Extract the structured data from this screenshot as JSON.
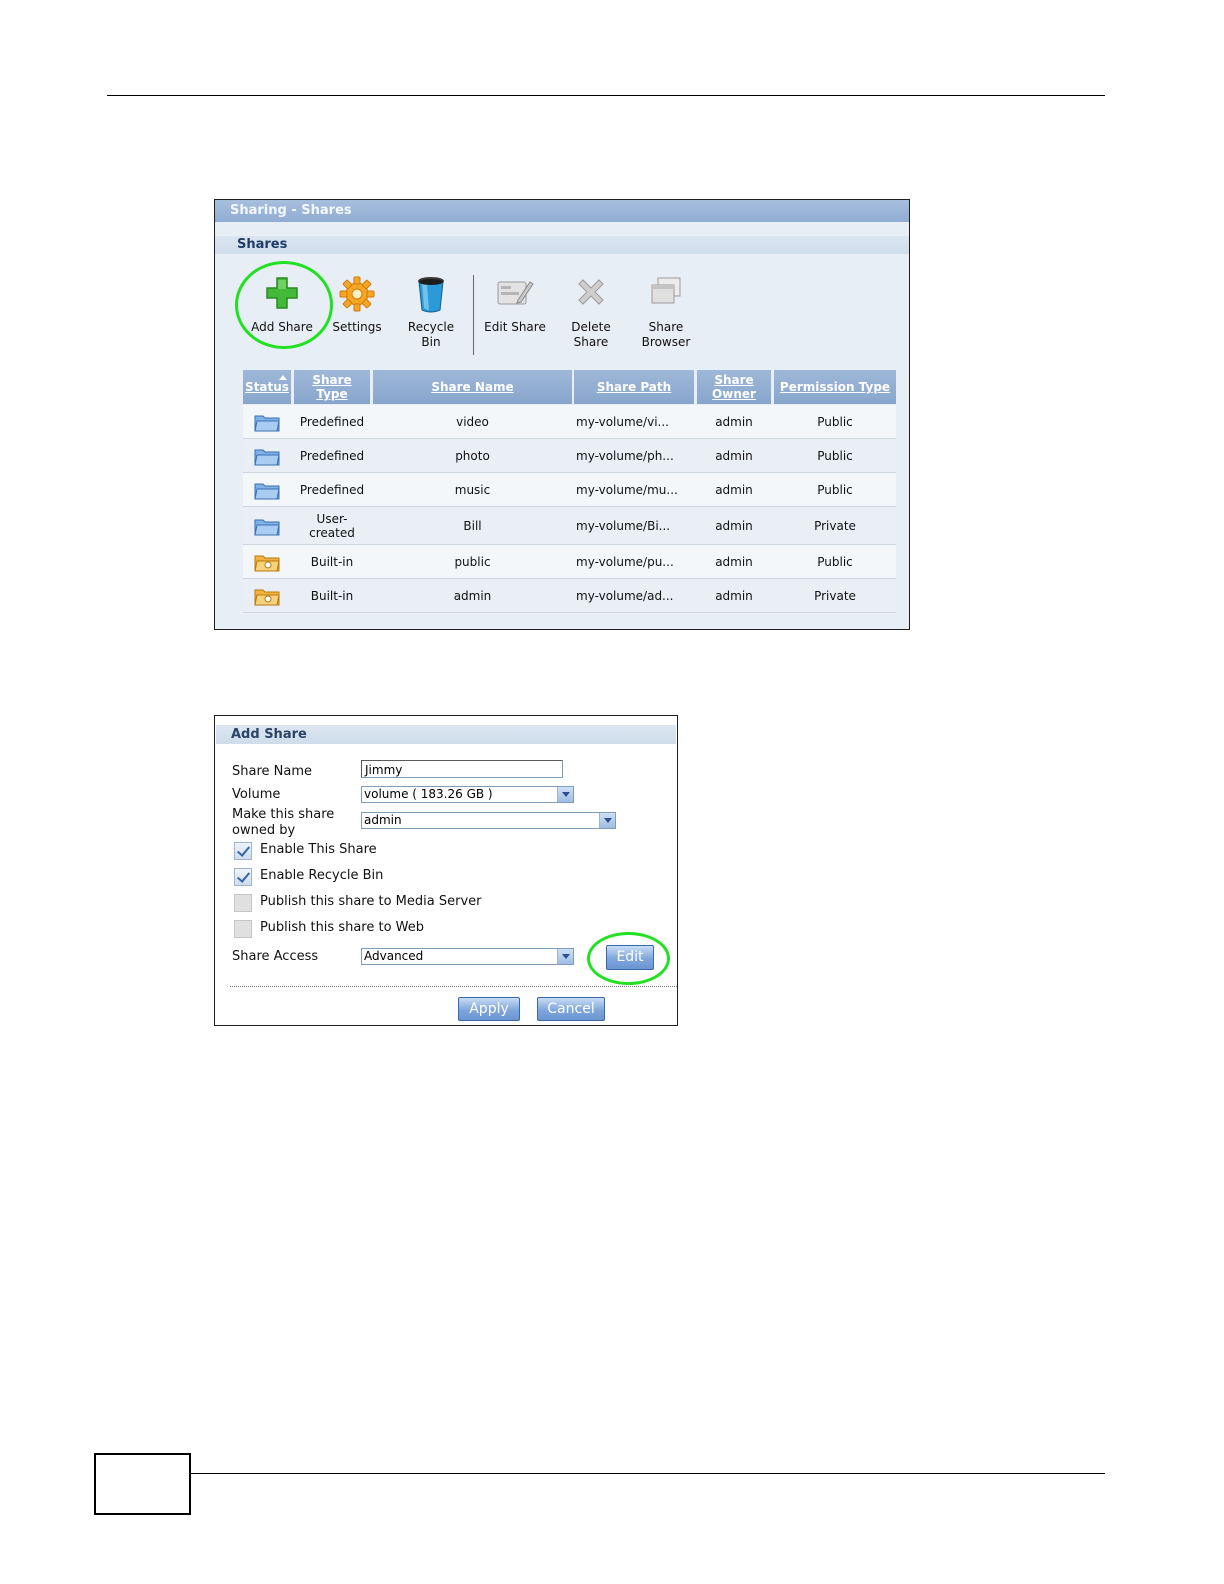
{
  "shares_panel": {
    "title": "Sharing - Shares",
    "section_title": "Shares",
    "toolbar": {
      "add_share": "Add Share",
      "settings": "Settings",
      "recycle_bin_1": "Recycle",
      "recycle_bin_2": "Bin",
      "edit_share": "Edit Share",
      "delete_share_1": "Delete",
      "delete_share_2": "Share",
      "share_browser_1": "Share",
      "share_browser_2": "Browser"
    },
    "columns": {
      "status": "Status",
      "share_type_1": "Share",
      "share_type_2": "Type",
      "share_name": "Share Name",
      "share_path": "Share Path",
      "share_owner_1": "Share",
      "share_owner_2": "Owner",
      "permission_type": "Permission Type"
    },
    "rows": [
      {
        "type": "Predefined",
        "name": "video",
        "path": "my-volume/vi...",
        "owner": "admin",
        "permission": "Public"
      },
      {
        "type": "Predefined",
        "name": "photo",
        "path": "my-volume/ph...",
        "owner": "admin",
        "permission": "Public"
      },
      {
        "type": "Predefined",
        "name": "music",
        "path": "my-volume/mu...",
        "owner": "admin",
        "permission": "Public"
      },
      {
        "type_1": "User-",
        "type_2": "created",
        "name": "Bill",
        "path": "my-volume/Bi...",
        "owner": "admin",
        "permission": "Private"
      },
      {
        "type": "Built-in",
        "name": "public",
        "path": "my-volume/pu...",
        "owner": "admin",
        "permission": "Public"
      },
      {
        "type": "Built-in",
        "name": "admin",
        "path": "my-volume/ad...",
        "owner": "admin",
        "permission": "Private"
      }
    ]
  },
  "add_share_panel": {
    "title": "Add Share",
    "share_name_label": "Share Name",
    "share_name_value": "Jimmy",
    "volume_label": "Volume",
    "volume_value": "volume ( 183.26 GB )",
    "owner_label_1": "Make this share",
    "owner_label_2": "owned by",
    "owner_value": "admin",
    "enable_share": "Enable This Share",
    "enable_recycle": "Enable Recycle Bin",
    "publish_media": "Publish this share to Media Server",
    "publish_web": "Publish this share to Web",
    "share_access_label": "Share Access",
    "share_access_value": "Advanced",
    "edit_button": "Edit",
    "apply_button": "Apply",
    "cancel_button": "Cancel"
  },
  "colors": {
    "highlight_ring": "#22e022",
    "title_bar": "#8facd2",
    "header_bg": "#87a5cc"
  }
}
